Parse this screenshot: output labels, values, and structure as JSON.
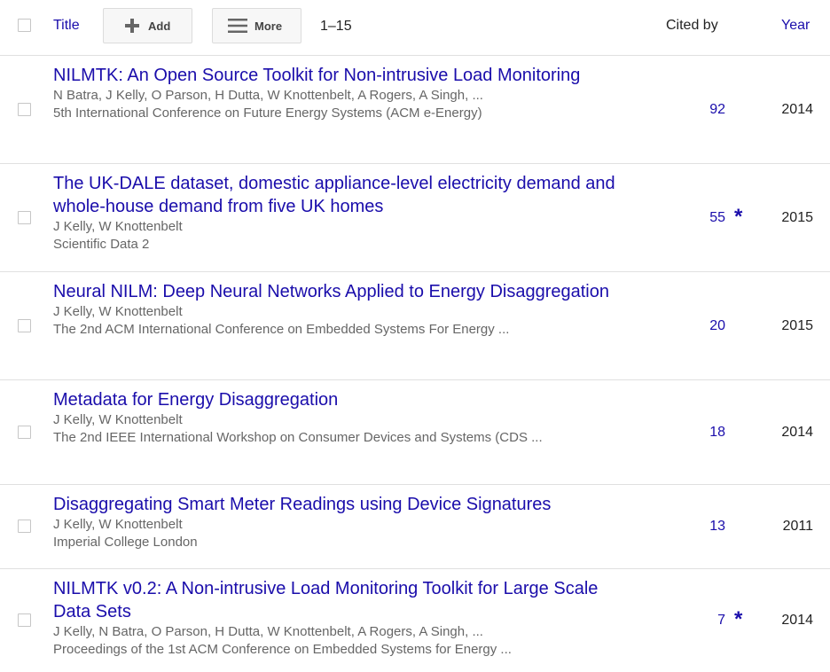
{
  "header": {
    "title_label": "Title",
    "add_label": "Add",
    "more_label": "More",
    "range": "1–15",
    "cited_by_label": "Cited by",
    "year_label": "Year",
    "add_icon": "plus-icon",
    "more_icon": "menu-icon"
  },
  "colors": {
    "link": "#1a0dab",
    "meta": "#666666",
    "divider": "#e0e0e0"
  },
  "articles": [
    {
      "title": "NILMTK: An Open Source Toolkit for Non-intrusive Load Monitoring",
      "authors": "N Batra, J Kelly, O Parson, H Dutta, W Knottenbelt, A Rogers, A Singh, ...",
      "venue": "5th International Conference on Future Energy Systems (ACM e-Energy)",
      "cited_by": "92",
      "star": "",
      "year": "2014"
    },
    {
      "title": "The UK-DALE dataset, domestic appliance-level electricity demand and whole-house demand from five UK homes",
      "authors": "J Kelly, W Knottenbelt",
      "venue": "Scientific Data 2",
      "cited_by": "55",
      "star": "*",
      "year": "2015"
    },
    {
      "title": "Neural NILM: Deep Neural Networks Applied to Energy Disaggregation",
      "authors": "J Kelly, W Knottenbelt",
      "venue": "The 2nd ACM International Conference on Embedded Systems For Energy ...",
      "cited_by": "20",
      "star": "",
      "year": "2015"
    },
    {
      "title": "Metadata for Energy Disaggregation",
      "authors": "J Kelly, W Knottenbelt",
      "venue": "The 2nd IEEE International Workshop on Consumer Devices and Systems (CDS ...",
      "cited_by": "18",
      "star": "",
      "year": "2014"
    },
    {
      "title": "Disaggregating Smart Meter Readings using Device Signatures",
      "authors": "J Kelly, W Knottenbelt",
      "venue": "Imperial College London",
      "cited_by": "13",
      "star": "",
      "year": "2011"
    },
    {
      "title": "NILMTK v0.2: A Non-intrusive Load Monitoring Toolkit for Large Scale Data Sets",
      "authors": "J Kelly, N Batra, O Parson, H Dutta, W Knottenbelt, A Rogers, A Singh, ...",
      "venue": "Proceedings of the 1st ACM Conference on Embedded Systems for Energy ...",
      "cited_by": "7",
      "star": "*",
      "year": "2014"
    }
  ]
}
